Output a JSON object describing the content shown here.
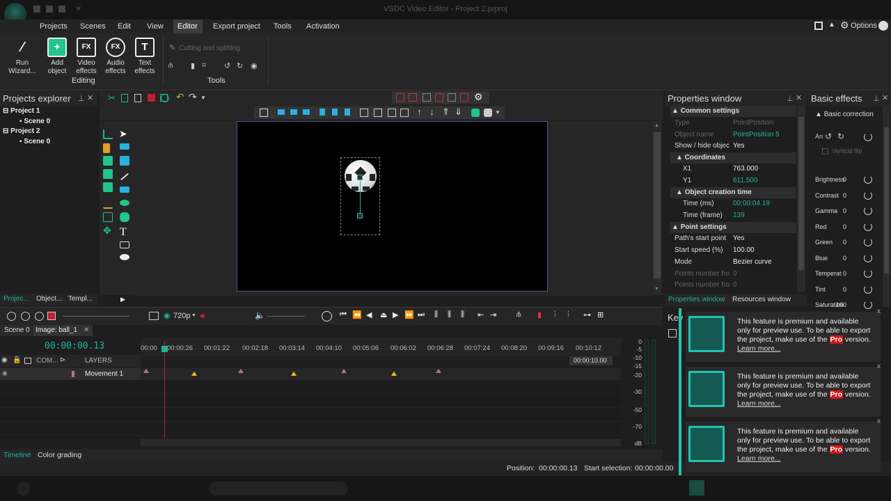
{
  "window": {
    "title": "VSDC Video Editor - Project 2.prproj"
  },
  "menu": {
    "items": [
      "Projects",
      "Scenes",
      "Edit",
      "View",
      "Editor",
      "Export project",
      "Tools",
      "Activation"
    ],
    "active": "Editor",
    "options_label": "Options"
  },
  "ribbon": {
    "run_wizard": "Run Wizard...",
    "add_object": "Add object",
    "video_effects": "Video effects",
    "audio_effects": "Audio effects",
    "text_effects": "Text effects",
    "editing_group": "Editing",
    "cutting_splitting": "Cutting and splitting",
    "tools_group": "Tools"
  },
  "projects_explorer": {
    "title": "Projects explorer",
    "tree": [
      {
        "label": "Project 1",
        "child": "Scene 0"
      },
      {
        "label": "Project 2",
        "child": "Scene 0"
      }
    ],
    "bottom_tabs": [
      "Projec...",
      "Object...",
      "Templ..."
    ]
  },
  "preview": {
    "resolution": "720p"
  },
  "properties": {
    "title": "Properties window",
    "common_settings": "Common settings",
    "type_label": "Type",
    "type_value": "PointPosition",
    "object_name_label": "Object name",
    "object_name_value": "PointPosition 5",
    "show_hide_label": "Show / hide objec",
    "show_hide_value": "Yes",
    "coordinates": "Coordinates",
    "x1_label": "X1",
    "x1_value": "763.000",
    "y1_label": "Y1",
    "y1_value": "611.500",
    "object_creation_time": "Object creation time",
    "time_ms_label": "Time (ms)",
    "time_ms_value": "00:00:04.19",
    "time_frame_label": "Time (frame)",
    "time_frame_value": "139",
    "point_settings": "Point settings",
    "path_start_label": "Path's start point",
    "path_start_value": "Yes",
    "start_speed_label": "Start speed (%)",
    "start_speed_value": "100.00",
    "mode_label": "Mode",
    "mode_value": "Bezier curve",
    "points_from_label_1": "Points number fro",
    "points_from_value_1": "0",
    "points_from_label_2": "Points number fro",
    "points_from_value_2": "0",
    "tab_properties": "Properties window",
    "tab_resources": "Resources window"
  },
  "basic_effects": {
    "title": "Basic effects",
    "basic_correction": "Basic correction",
    "vertical_flip": "Vertical flip",
    "rows": [
      {
        "label": "Brightness",
        "value": "0"
      },
      {
        "label": "Contrast",
        "value": "0"
      },
      {
        "label": "Gamma",
        "value": "0"
      },
      {
        "label": "Red",
        "value": "0"
      },
      {
        "label": "Green",
        "value": "0"
      },
      {
        "label": "Blue",
        "value": "0"
      },
      {
        "label": "Temperat",
        "value": "0"
      },
      {
        "label": "Tint",
        "value": "0"
      },
      {
        "label": "Saturation",
        "value": "100"
      }
    ]
  },
  "timeline": {
    "tabs": [
      "Scene 0",
      "Image: ball_1"
    ],
    "current_time": "00:00:00.13",
    "ruler": [
      "00:00",
      "00:00:26",
      "00:01:22",
      "00:02:18",
      "00:03:14",
      "00:04:10",
      "00:05:06",
      "00:06:02",
      "00:06:28",
      "00:07:24",
      "00:08:20",
      "00:09:16",
      "00:10:12"
    ],
    "end_time": "00:00:10.00",
    "com_label": "COM...",
    "layers_label": "LAYERS",
    "track_label": "Movement 1",
    "db_scale": [
      "0",
      "-5",
      "-10",
      "-15",
      "-20",
      "-30",
      "-50",
      "-70",
      "dB"
    ],
    "bottom_tabs": [
      "Timeline",
      "Color grading"
    ]
  },
  "status": {
    "position_label": "Position:",
    "position_value": "00:00:00.13",
    "start_selection_label": "Start selection:",
    "start_selection_value": "00:00:00.00"
  },
  "keyframes_partial": "Key",
  "notifications": [
    {
      "text_before": "This feature is premium and available only for preview use. To be able to export the project, make use of the ",
      "pro": "Pro",
      "text_after": " version.",
      "link": "Learn more..."
    },
    {
      "text_before": "This feature is premium and available only for preview use. To be able to export the project, make use of the ",
      "pro": "Pro",
      "text_after": " version.",
      "link": "Learn more..."
    },
    {
      "text_before": "This feature is premium and available only for preview use. To be able to export the project, make use of the ",
      "pro": "Pro",
      "text_after": " version.",
      "link": "Learn more..."
    }
  ],
  "colors": {
    "accent": "#1fb59c",
    "pro_badge": "#d01818",
    "marker_yellow": "#f0c020"
  }
}
